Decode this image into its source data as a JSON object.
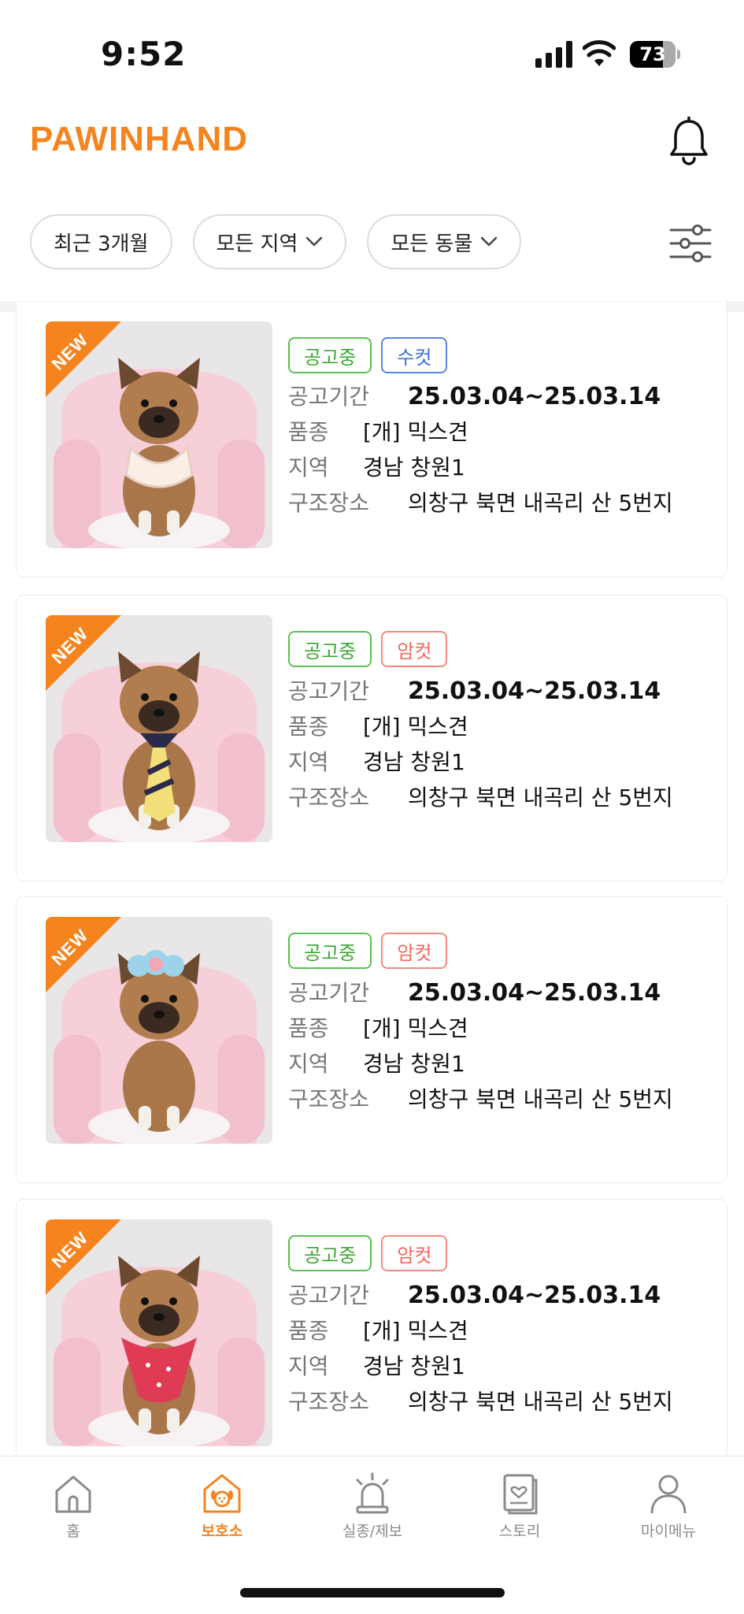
{
  "status_bar": {
    "time": "9:52",
    "battery": "73",
    "battery_level": 0.73
  },
  "header": {
    "logo": "PAWINHAND"
  },
  "filters": {
    "period": "최근 3개월",
    "region": "모든 지역",
    "animal": "모든 동물"
  },
  "labels": {
    "period": "공고기간",
    "breed": "품종",
    "region": "지역",
    "rescue_place": "구조장소",
    "new_badge": "NEW"
  },
  "cards": [
    {
      "status": "공고중",
      "gender": "수컷",
      "gender_type": "male",
      "period": "25.03.04~25.03.14",
      "breed": "[개] 믹스견",
      "region": "경남 창원1",
      "rescue_place": "의창구 북면 내곡리 산 5번지",
      "accessory": "bib"
    },
    {
      "status": "공고중",
      "gender": "암컷",
      "gender_type": "female",
      "period": "25.03.04~25.03.14",
      "breed": "[개] 믹스견",
      "region": "경남 창원1",
      "rescue_place": "의창구 북면 내곡리 산 5번지",
      "accessory": "tie"
    },
    {
      "status": "공고중",
      "gender": "암컷",
      "gender_type": "female",
      "period": "25.03.04~25.03.14",
      "breed": "[개] 믹스견",
      "region": "경남 창원1",
      "rescue_place": "의창구 북면 내곡리 산 5번지",
      "accessory": "flower"
    },
    {
      "status": "공고중",
      "gender": "암컷",
      "gender_type": "female",
      "period": "25.03.04~25.03.14",
      "breed": "[개] 믹스견",
      "region": "경남 창원1",
      "rescue_place": "의창구 북면 내곡리 산 5번지",
      "accessory": "scarf"
    }
  ],
  "nav": {
    "items": [
      {
        "label": "홈",
        "icon": "home-icon"
      },
      {
        "label": "보호소",
        "icon": "shelter-icon",
        "active": true
      },
      {
        "label": "실종/제보",
        "icon": "siren-icon"
      },
      {
        "label": "스토리",
        "icon": "story-icon"
      },
      {
        "label": "마이메뉴",
        "icon": "person-icon"
      }
    ]
  },
  "colors": {
    "accent": "#f5841f",
    "status_green": "#3aa830",
    "male_blue": "#3d6fd6",
    "female_red": "#ef6a5f"
  }
}
